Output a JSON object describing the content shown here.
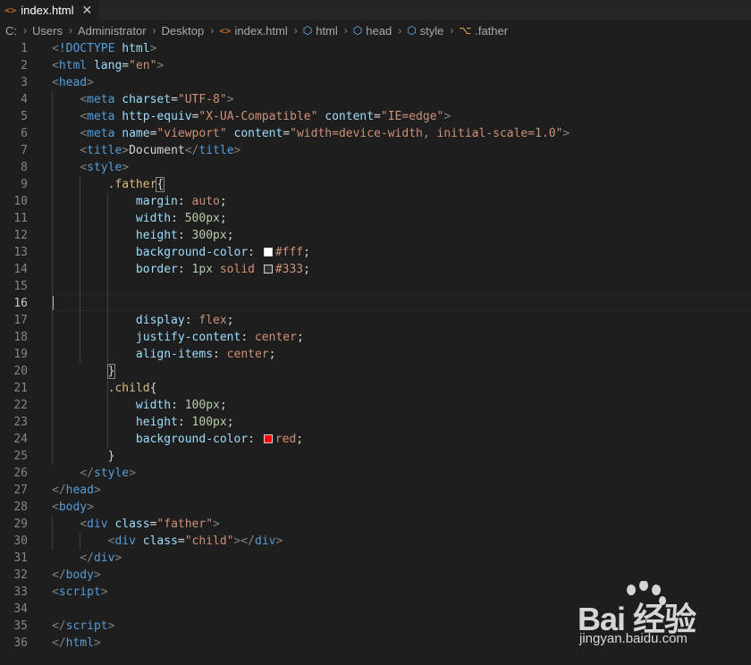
{
  "tab": {
    "icon": "html-file-icon",
    "label": "index.html",
    "close": "✕"
  },
  "breadcrumb": [
    "C:",
    "Users",
    "Administrator",
    "Desktop",
    "index.html",
    "html",
    "head",
    "style",
    ".father"
  ],
  "editor": {
    "active_line": 16,
    "lines": [
      [
        [
          "p",
          "<"
        ],
        [
          "t",
          "!DOCTYPE"
        ],
        [
          "w",
          " "
        ],
        [
          "a",
          "html"
        ],
        [
          "p",
          ">"
        ]
      ],
      [
        [
          "p",
          "<"
        ],
        [
          "t",
          "html"
        ],
        [
          "w",
          " "
        ],
        [
          "a",
          "lang"
        ],
        [
          "w",
          "="
        ],
        [
          "s",
          "\"en\""
        ],
        [
          "p",
          ">"
        ]
      ],
      [
        [
          "p",
          "<"
        ],
        [
          "t",
          "head"
        ],
        [
          "p",
          ">"
        ]
      ],
      [
        [
          "w",
          "    "
        ],
        [
          "p",
          "<"
        ],
        [
          "t",
          "meta"
        ],
        [
          "w",
          " "
        ],
        [
          "a",
          "charset"
        ],
        [
          "w",
          "="
        ],
        [
          "s",
          "\"UTF-8\""
        ],
        [
          "p",
          ">"
        ]
      ],
      [
        [
          "w",
          "    "
        ],
        [
          "p",
          "<"
        ],
        [
          "t",
          "meta"
        ],
        [
          "w",
          " "
        ],
        [
          "a",
          "http-equiv"
        ],
        [
          "w",
          "="
        ],
        [
          "s",
          "\"X-UA-Compatible\""
        ],
        [
          "w",
          " "
        ],
        [
          "a",
          "content"
        ],
        [
          "w",
          "="
        ],
        [
          "s",
          "\"IE=edge\""
        ],
        [
          "p",
          ">"
        ]
      ],
      [
        [
          "w",
          "    "
        ],
        [
          "p",
          "<"
        ],
        [
          "t",
          "meta"
        ],
        [
          "w",
          " "
        ],
        [
          "a",
          "name"
        ],
        [
          "w",
          "="
        ],
        [
          "s",
          "\"viewport\""
        ],
        [
          "w",
          " "
        ],
        [
          "a",
          "content"
        ],
        [
          "w",
          "="
        ],
        [
          "s",
          "\"width=device-width, initial-scale=1.0\""
        ],
        [
          "p",
          ">"
        ]
      ],
      [
        [
          "w",
          "    "
        ],
        [
          "p",
          "<"
        ],
        [
          "t",
          "title"
        ],
        [
          "p",
          ">"
        ],
        [
          "w",
          "Document"
        ],
        [
          "p",
          "</"
        ],
        [
          "t",
          "title"
        ],
        [
          "p",
          ">"
        ]
      ],
      [
        [
          "w",
          "    "
        ],
        [
          "p",
          "<"
        ],
        [
          "t",
          "style"
        ],
        [
          "p",
          ">"
        ]
      ],
      [
        [
          "w",
          "        "
        ],
        [
          "sel",
          ".father"
        ],
        [
          "brk",
          "{"
        ]
      ],
      [
        [
          "w",
          "            "
        ],
        [
          "a",
          "margin"
        ],
        [
          "w",
          ": "
        ],
        [
          "s",
          "auto"
        ],
        [
          "w",
          ";"
        ]
      ],
      [
        [
          "w",
          "            "
        ],
        [
          "a",
          "width"
        ],
        [
          "w",
          ": "
        ],
        [
          "n",
          "500px"
        ],
        [
          "w",
          ";"
        ]
      ],
      [
        [
          "w",
          "            "
        ],
        [
          "a",
          "height"
        ],
        [
          "w",
          ": "
        ],
        [
          "n",
          "300px"
        ],
        [
          "w",
          ";"
        ]
      ],
      [
        [
          "w",
          "            "
        ],
        [
          "a",
          "background-color"
        ],
        [
          "w",
          ": "
        ],
        [
          "sw",
          "#ffffff"
        ],
        [
          "s",
          "#fff"
        ],
        [
          "w",
          ";"
        ]
      ],
      [
        [
          "w",
          "            "
        ],
        [
          "a",
          "border"
        ],
        [
          "w",
          ": "
        ],
        [
          "n",
          "1px"
        ],
        [
          "w",
          " "
        ],
        [
          "s",
          "solid"
        ],
        [
          "w",
          " "
        ],
        [
          "sw",
          "#333333"
        ],
        [
          "s",
          "#333"
        ],
        [
          "w",
          ";"
        ]
      ],
      [],
      [],
      [
        [
          "w",
          "            "
        ],
        [
          "a",
          "display"
        ],
        [
          "w",
          ": "
        ],
        [
          "s",
          "flex"
        ],
        [
          "w",
          ";"
        ]
      ],
      [
        [
          "w",
          "            "
        ],
        [
          "a",
          "justify-content"
        ],
        [
          "w",
          ": "
        ],
        [
          "s",
          "center"
        ],
        [
          "w",
          ";"
        ]
      ],
      [
        [
          "w",
          "            "
        ],
        [
          "a",
          "align-items"
        ],
        [
          "w",
          ": "
        ],
        [
          "s",
          "center"
        ],
        [
          "w",
          ";"
        ]
      ],
      [
        [
          "w",
          "        "
        ],
        [
          "brk",
          "}"
        ]
      ],
      [
        [
          "w",
          "        "
        ],
        [
          "sel",
          ".child"
        ],
        [
          "w",
          "{"
        ]
      ],
      [
        [
          "w",
          "            "
        ],
        [
          "a",
          "width"
        ],
        [
          "w",
          ": "
        ],
        [
          "n",
          "100px"
        ],
        [
          "w",
          ";"
        ]
      ],
      [
        [
          "w",
          "            "
        ],
        [
          "a",
          "height"
        ],
        [
          "w",
          ": "
        ],
        [
          "n",
          "100px"
        ],
        [
          "w",
          ";"
        ]
      ],
      [
        [
          "w",
          "            "
        ],
        [
          "a",
          "background-color"
        ],
        [
          "w",
          ": "
        ],
        [
          "sw",
          "#ff0000"
        ],
        [
          "s",
          "red"
        ],
        [
          "w",
          ";"
        ]
      ],
      [
        [
          "w",
          "        "
        ],
        [
          "w",
          "}"
        ]
      ],
      [
        [
          "w",
          "    "
        ],
        [
          "p",
          "</"
        ],
        [
          "t",
          "style"
        ],
        [
          "p",
          ">"
        ]
      ],
      [
        [
          "p",
          "</"
        ],
        [
          "t",
          "head"
        ],
        [
          "p",
          ">"
        ]
      ],
      [
        [
          "p",
          "<"
        ],
        [
          "t",
          "body"
        ],
        [
          "p",
          ">"
        ]
      ],
      [
        [
          "w",
          "    "
        ],
        [
          "p",
          "<"
        ],
        [
          "t",
          "div"
        ],
        [
          "w",
          " "
        ],
        [
          "a",
          "class"
        ],
        [
          "w",
          "="
        ],
        [
          "s",
          "\"father\""
        ],
        [
          "p",
          ">"
        ]
      ],
      [
        [
          "w",
          "        "
        ],
        [
          "p",
          "<"
        ],
        [
          "t",
          "div"
        ],
        [
          "w",
          " "
        ],
        [
          "a",
          "class"
        ],
        [
          "w",
          "="
        ],
        [
          "s",
          "\"child\""
        ],
        [
          "p",
          "></"
        ],
        [
          "t",
          "div"
        ],
        [
          "p",
          ">"
        ]
      ],
      [
        [
          "w",
          "    "
        ],
        [
          "p",
          "</"
        ],
        [
          "t",
          "div"
        ],
        [
          "p",
          ">"
        ]
      ],
      [
        [
          "p",
          "</"
        ],
        [
          "t",
          "body"
        ],
        [
          "p",
          ">"
        ]
      ],
      [
        [
          "p",
          "<"
        ],
        [
          "t",
          "script"
        ],
        [
          "p",
          ">"
        ]
      ],
      [],
      [
        [
          "p",
          "</"
        ],
        [
          "t",
          "script"
        ],
        [
          "p",
          ">"
        ]
      ],
      [
        [
          "p",
          "</"
        ],
        [
          "t",
          "html"
        ],
        [
          "p",
          ">"
        ]
      ]
    ]
  },
  "watermark": {
    "main": "Bai  经验",
    "sub": "jingyan.baidu.com"
  }
}
